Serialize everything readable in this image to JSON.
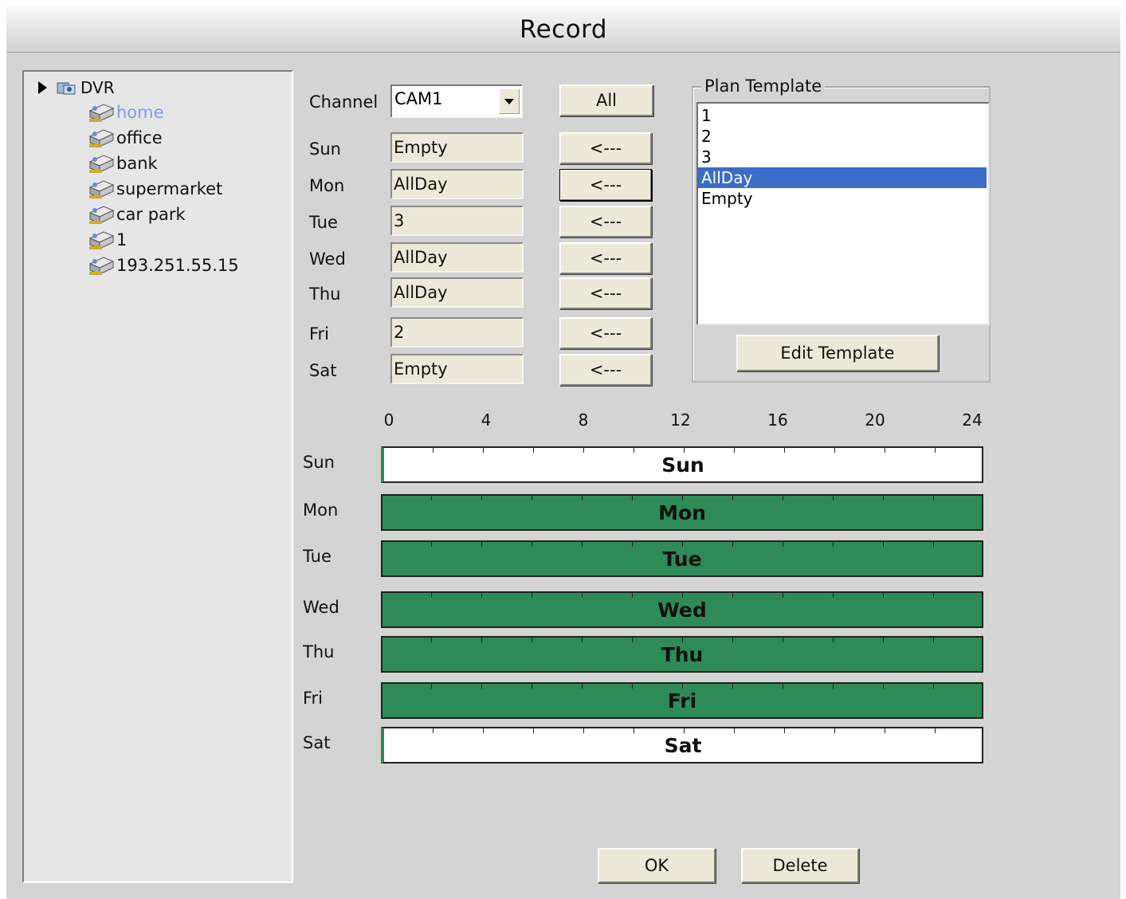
{
  "window": {
    "title": "Record"
  },
  "tree": {
    "root": "DVR",
    "items": [
      "home",
      "office",
      "bank",
      "supermarket",
      "car park",
      "1",
      "193.251.55.15"
    ],
    "selected_index": 0
  },
  "channel": {
    "label": "Channel",
    "value": "CAM1",
    "all_button": "All"
  },
  "days": [
    {
      "label": "Sun",
      "plan": "Empty",
      "apply": "<---"
    },
    {
      "label": "Mon",
      "plan": "AllDay",
      "apply": "<---"
    },
    {
      "label": "Tue",
      "plan": "3",
      "apply": "<---"
    },
    {
      "label": "Wed",
      "plan": "AllDay",
      "apply": "<---"
    },
    {
      "label": "Thu",
      "plan": "AllDay",
      "apply": "<---"
    },
    {
      "label": "Fri",
      "plan": "2",
      "apply": "<---"
    },
    {
      "label": "Sat",
      "plan": "Empty",
      "apply": "<---"
    }
  ],
  "plan_template": {
    "title": "Plan Template",
    "items": [
      "1",
      "2",
      "3",
      "AllDay",
      "Empty"
    ],
    "selected_index": 3,
    "edit_button": "Edit Template"
  },
  "timeline": {
    "axis": [
      "0",
      "4",
      "8",
      "12",
      "16",
      "20",
      "24"
    ],
    "rows": [
      {
        "label": "Sun",
        "name": "Sun",
        "recorded": false
      },
      {
        "label": "Mon",
        "name": "Mon",
        "recorded": true
      },
      {
        "label": "Tue",
        "name": "Tue",
        "recorded": true
      },
      {
        "label": "Wed",
        "name": "Wed",
        "recorded": true
      },
      {
        "label": "Thu",
        "name": "Thu",
        "recorded": true
      },
      {
        "label": "Fri",
        "name": "Fri",
        "recorded": true
      },
      {
        "label": "Sat",
        "name": "Sat",
        "recorded": false
      }
    ],
    "record_color": "#2e8b57"
  },
  "footer": {
    "ok": "OK",
    "delete": "Delete"
  }
}
